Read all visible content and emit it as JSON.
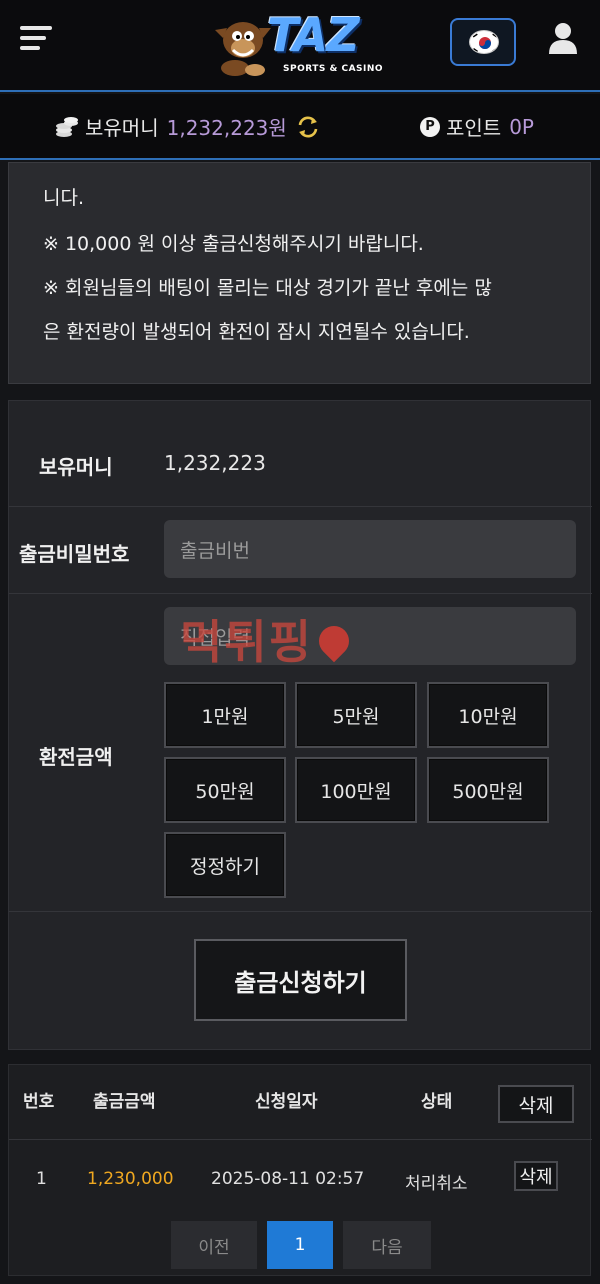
{
  "header": {
    "logo_text": "TAZ",
    "logo_subtitle": "SPORTS & CASINO"
  },
  "balance_bar": {
    "money_label": "보유머니",
    "money_value": "1,232,223원",
    "point_badge": "P",
    "point_label": "포인트",
    "point_value": "0P"
  },
  "notice": {
    "lines": [
      "니다.",
      "※ 10,000 원 이상 출금신청해주시기 바랍니다.",
      "※ 회원님들의 배팅이 몰리는 대상 경기가 끝난 후에는 많",
      "은 환전량이 발생되어 환전이 잠시 지연될수 있습니다."
    ]
  },
  "form": {
    "balance_label": "보유머니",
    "balance_value": "1,232,223",
    "password_label": "출금비밀번호",
    "password_placeholder": "출금비번",
    "amount_label": "환전금액",
    "amount_placeholder": "직접입력",
    "amount_buttons": [
      "1만원",
      "5만원",
      "10만원",
      "50만원",
      "100만원",
      "500만원"
    ],
    "reset_button": "정정하기",
    "submit_button": "출금신청하기"
  },
  "watermark": "먹튀핑",
  "table": {
    "headers": [
      "번호",
      "출금금액",
      "신청일자",
      "상태",
      "삭제"
    ],
    "rows": [
      {
        "no": "1",
        "amount": "1,230,000",
        "date": "2025-08-11 02:57",
        "status": "처리취소",
        "delete": "삭제"
      }
    ]
  },
  "pagination": {
    "prev": "이전",
    "current": "1",
    "next": "다음"
  }
}
